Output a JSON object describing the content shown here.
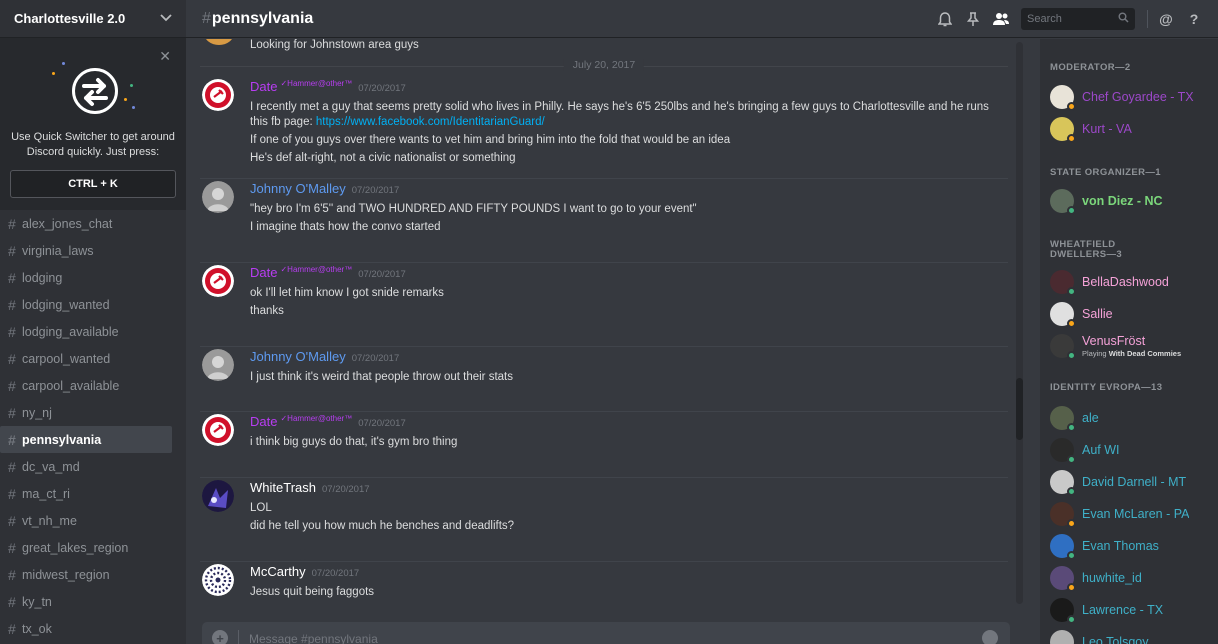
{
  "server": {
    "name": "Charlottesville 2.0"
  },
  "quick_switcher": {
    "text": "Use Quick Switcher to get around Discord quickly. Just press:",
    "shortcut": "CTRL + K"
  },
  "channels": [
    {
      "name": "alex_jones_chat",
      "active": false
    },
    {
      "name": "virginia_laws",
      "active": false
    },
    {
      "name": "lodging",
      "active": false
    },
    {
      "name": "lodging_wanted",
      "active": false
    },
    {
      "name": "lodging_available",
      "active": false
    },
    {
      "name": "carpool_wanted",
      "active": false
    },
    {
      "name": "carpool_available",
      "active": false
    },
    {
      "name": "ny_nj",
      "active": false
    },
    {
      "name": "pennsylvania",
      "active": true
    },
    {
      "name": "dc_va_md",
      "active": false
    },
    {
      "name": "ma_ct_ri",
      "active": false
    },
    {
      "name": "vt_nh_me",
      "active": false
    },
    {
      "name": "great_lakes_region",
      "active": false
    },
    {
      "name": "midwest_region",
      "active": false
    },
    {
      "name": "ky_tn",
      "active": false
    },
    {
      "name": "tx_ok",
      "active": false
    }
  ],
  "header": {
    "hash": "#",
    "channel": "pennsylvania",
    "search_placeholder": "Search",
    "mention_icon": "@",
    "help_icon": "?"
  },
  "messages": {
    "partial_text": "Looking for Johnstown area guys",
    "date_divider": "July 20, 2017",
    "items": [
      {
        "author": "Date",
        "author_color": "#b83df2",
        "tag": "✓Hammer@other™",
        "avatar": "arm-hammer",
        "timestamp": "07/20/2017",
        "lines": [
          {
            "text": "I recently met a guy that seems pretty solid who lives in Philly. He says he's 6'5 250lbs and he's bringing a few guys to Charlottesville and he runs this fb page: ",
            "link": "https://www.facebook.com/IdentitarianGuard/"
          },
          {
            "text": "If one of you guys over there wants to vet him and bring him into the fold that would be an idea"
          },
          {
            "text": "He's def alt-right, not a civic nationalist or something"
          }
        ]
      },
      {
        "author": "Johnny O'Malley",
        "author_color": "#5e9af0",
        "avatar": "portrait",
        "timestamp": "07/20/2017",
        "lines": [
          {
            "text": "\"hey bro I'm 6'5'' and TWO HUNDRED AND FIFTY POUNDS I want to go to your event\""
          },
          {
            "text": "I imagine thats how the convo started"
          }
        ]
      },
      {
        "author": "Date",
        "author_color": "#b83df2",
        "tag": "✓Hammer@other™",
        "avatar": "arm-hammer",
        "timestamp": "07/20/2017",
        "lines": [
          {
            "text": "ok I'll let him know I got snide remarks"
          },
          {
            "text": "thanks"
          }
        ]
      },
      {
        "author": "Johnny O'Malley",
        "author_color": "#5e9af0",
        "avatar": "portrait",
        "timestamp": "07/20/2017",
        "lines": [
          {
            "text": "I just think it's weird that people throw out their stats"
          }
        ]
      },
      {
        "author": "Date",
        "author_color": "#b83df2",
        "tag": "✓Hammer@other™",
        "avatar": "arm-hammer",
        "timestamp": "07/20/2017",
        "lines": [
          {
            "text": "i think big guys do that, it's gym bro thing"
          }
        ]
      },
      {
        "author": "WhiteTrash",
        "author_color": "#ffffff",
        "avatar": "dark-purple",
        "timestamp": "07/20/2017",
        "lines": [
          {
            "text": "LOL"
          },
          {
            "text": "did he tell you how much he benches and deadlifts?"
          }
        ]
      },
      {
        "author": "McCarthy",
        "author_color": "#ffffff",
        "avatar": "snowflake",
        "timestamp": "07/20/2017",
        "lines": [
          {
            "text": "Jesus quit being faggots"
          }
        ]
      }
    ]
  },
  "composer": {
    "placeholder": "Message #pennsylvania"
  },
  "member_groups": [
    {
      "title": "MODERATOR—2",
      "members": [
        {
          "name": "Chef Goyardee - TX",
          "color": "#9c48c9",
          "status": "#faa61a",
          "avatar_color": "#e8e3d8"
        },
        {
          "name": "Kurt - VA",
          "color": "#9c48c9",
          "status": "#faa61a",
          "avatar_color": "#d8c55a"
        }
      ]
    },
    {
      "title": "STATE ORGANIZER—1",
      "members": [
        {
          "name": "von Diez - NC",
          "color": "#7bd67b",
          "status": "#43b581",
          "avatar_color": "#5c6b5c",
          "bold": true
        }
      ]
    },
    {
      "title": "WHEATFIELD DWELLERS—3",
      "members": [
        {
          "name": "BellaDashwood",
          "color": "#f5a2d8",
          "status": "#43b581",
          "avatar_color": "#4a2a30"
        },
        {
          "name": "Sallie",
          "color": "#f5a2d8",
          "status": "#faa61a",
          "avatar_color": "#e0e0e0"
        },
        {
          "name": "VenusFröst",
          "color": "#f5a2d8",
          "status": "#43b581",
          "avatar_color": "#3a3a3a",
          "activity_prefix": "Playing ",
          "activity": "With Dead Commies"
        }
      ]
    },
    {
      "title": "IDENTITY EVROPA—13",
      "members": [
        {
          "name": "ale",
          "color": "#3fb0c8",
          "status": "#43b581",
          "avatar_color": "#56604a"
        },
        {
          "name": "Auf WI",
          "color": "#3fb0c8",
          "status": "#43b581",
          "avatar_color": "#2a2a2a"
        },
        {
          "name": "David Darnell - MT",
          "color": "#3fb0c8",
          "status": "#43b581",
          "avatar_color": "#c9c9c9"
        },
        {
          "name": "Evan McLaren - PA",
          "color": "#3fb0c8",
          "status": "#faa61a",
          "avatar_color": "#4a3028"
        },
        {
          "name": "Evan Thomas",
          "color": "#3fb0c8",
          "status": "#43b581",
          "avatar_color": "#2f6fc2"
        },
        {
          "name": "huwhite_id",
          "color": "#3fb0c8",
          "status": "#faa61a",
          "avatar_color": "#5a4a78"
        },
        {
          "name": "Lawrence - TX",
          "color": "#3fb0c8",
          "status": "#43b581",
          "avatar_color": "#1a1a1a"
        },
        {
          "name": "Leo Tolsgoy",
          "color": "#3fb0c8",
          "status": "#43b581",
          "avatar_color": "#b0b0b0"
        }
      ]
    }
  ]
}
